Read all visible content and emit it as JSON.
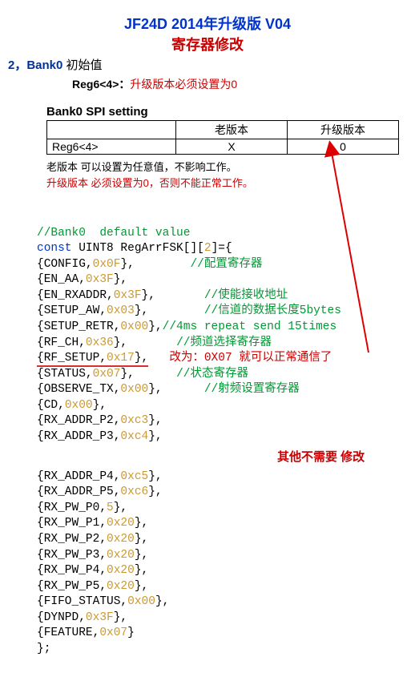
{
  "title": "JF24D 2014年升级版 V04",
  "subtitle": "寄存器修改",
  "section": {
    "num": "2，",
    "label": "Bank0",
    "suffix": " 初始值"
  },
  "regLine": {
    "label": "Reg6<4>：",
    "text": "升级版本必须设置为0"
  },
  "tbl": {
    "caption": "Bank0 SPI setting",
    "h_old": "老版本",
    "h_new": "升级版本",
    "row_label": "Reg6<4>",
    "row_old": "X",
    "row_new": "0"
  },
  "note_old": "老版本 可以设置为任意值，不影响工作。",
  "note_new": "升级版本 必须设置为0，否则不能正常工作。",
  "code": {
    "c1": "//Bank0  default value",
    "decl": {
      "const": "const",
      "type": "UINT8 RegArrFSK[][",
      "two": "2",
      "tail": "]={"
    },
    "l1": {
      "t": "{CONFIG,",
      "v": "0x0F",
      "e": "},        ",
      "c": "//配置寄存器"
    },
    "l2": {
      "t": "{EN_AA,",
      "v": "0x3F",
      "e": "},"
    },
    "l3": {
      "t": "{EN_RXADDR,",
      "v": "0x3F",
      "e": "},       ",
      "c": "//使能接收地址"
    },
    "l4": {
      "t": "{SETUP_AW,",
      "v": "0x03",
      "e": "},        ",
      "c": "//信道的数据长度5bytes"
    },
    "l5": {
      "t": "{SETUP_RETR,",
      "v": "0x00",
      "e": "},",
      "c": "//4ms repeat send 15times"
    },
    "l6": {
      "t": "{RF_CH,",
      "v": "0x36",
      "e": "},       ",
      "c": "//频道选择寄存器"
    },
    "l7": {
      "t": "{RF_SETUP,",
      "v": "0x17",
      "e": "},   ",
      "c": "改为：0X07 就可以正常通信了"
    },
    "l8": {
      "t": "{STATUS,",
      "v": "0x07",
      "e": "},      ",
      "c": "//状态寄存器"
    },
    "l9": {
      "t": "{OBSERVE_TX,",
      "v": "0x00",
      "e": "},      ",
      "c": "//射频设置寄存器"
    },
    "l10": {
      "t": "{CD,",
      "v": "0x00",
      "e": "},"
    },
    "l11": {
      "t": "{RX_ADDR_P2,",
      "v": "0xc3",
      "e": "},"
    },
    "l12": {
      "t": "{RX_ADDR_P3,",
      "v": "0xc4",
      "e": "},"
    },
    "l13": {
      "t": "{RX_ADDR_P4,",
      "v": "0xc5",
      "e": "},"
    },
    "l14": {
      "t": "{RX_ADDR_P5,",
      "v": "0xc6",
      "e": "},"
    },
    "l15": {
      "t": "{RX_PW_P0,",
      "v": "5",
      "e": "},"
    },
    "l16": {
      "t": "{RX_PW_P1,",
      "v": "0x20",
      "e": "},"
    },
    "l17": {
      "t": "{RX_PW_P2,",
      "v": "0x20",
      "e": "},"
    },
    "l18": {
      "t": "{RX_PW_P3,",
      "v": "0x20",
      "e": "},"
    },
    "l19": {
      "t": "{RX_PW_P4,",
      "v": "0x20",
      "e": "},"
    },
    "l20": {
      "t": "{RX_PW_P5,",
      "v": "0x20",
      "e": "},"
    },
    "l21": {
      "t": "{FIFO_STATUS,",
      "v": "0x00",
      "e": "},"
    },
    "l22": {
      "t": "{DYNPD,",
      "v": "0x3F",
      "e": "},"
    },
    "l23": {
      "t": "{FEATURE,",
      "v": "0x07",
      "e": "}"
    },
    "end": "};"
  },
  "otherNote": "其他不需要 修改"
}
